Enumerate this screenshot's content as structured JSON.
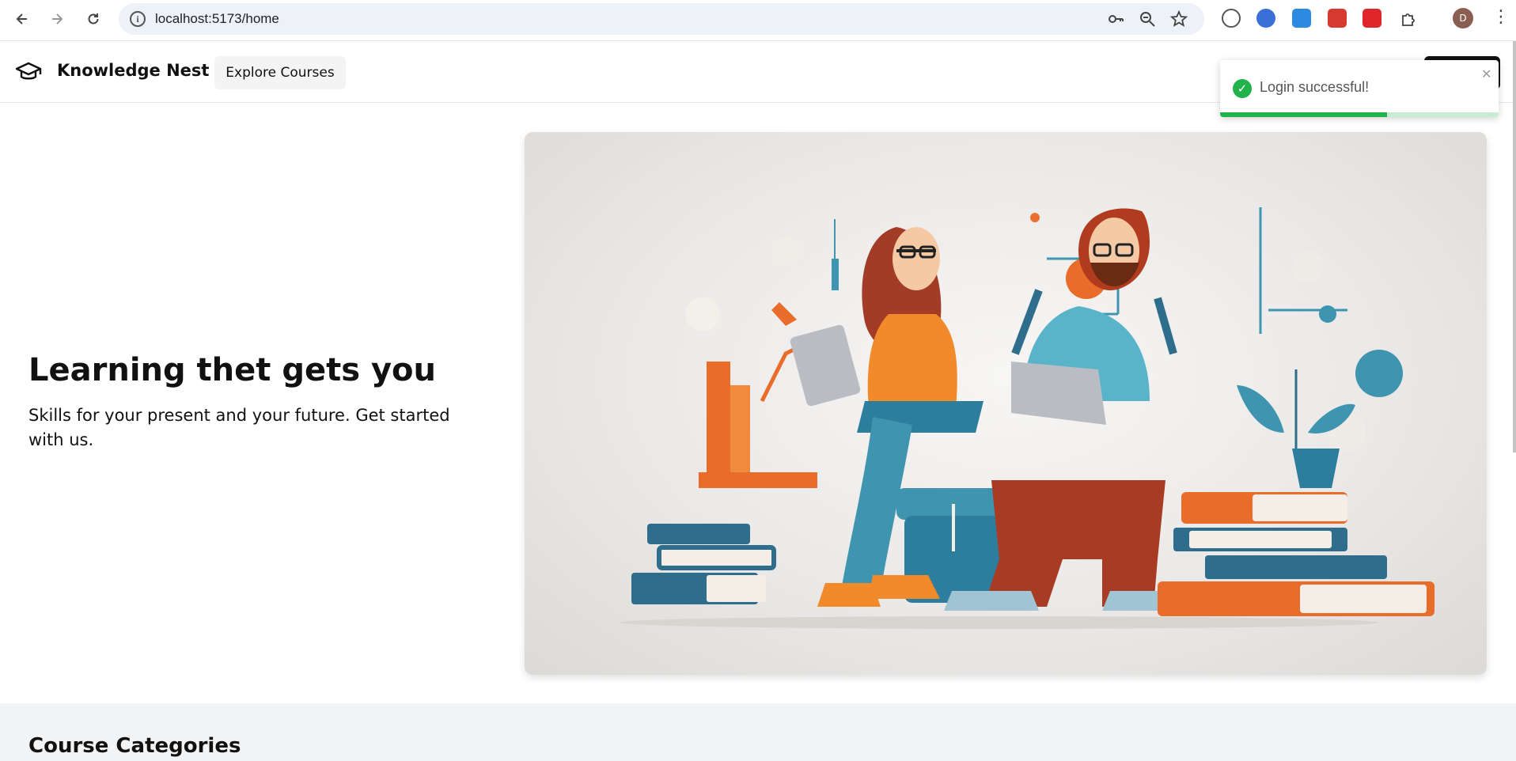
{
  "browser": {
    "url": "localhost:5173/home",
    "profile_initial": "D",
    "icons": [
      "back-arrow-icon",
      "forward-arrow-icon",
      "reload-icon",
      "site-info-icon",
      "password-key-icon",
      "zoom-icon",
      "bookmark-star-icon",
      "extensions-puzzle-icon",
      "more-menu-icon"
    ]
  },
  "header": {
    "brand": "Knowledge Nest",
    "explore_label": "Explore Courses"
  },
  "hero": {
    "title": "Learning thet gets you",
    "subtitle": "Skills for your present and your future. Get started with us."
  },
  "categories": {
    "title": "Course Categories"
  },
  "toast": {
    "message": "Login successful!",
    "progress": 0.6,
    "color": "#22b24c"
  }
}
